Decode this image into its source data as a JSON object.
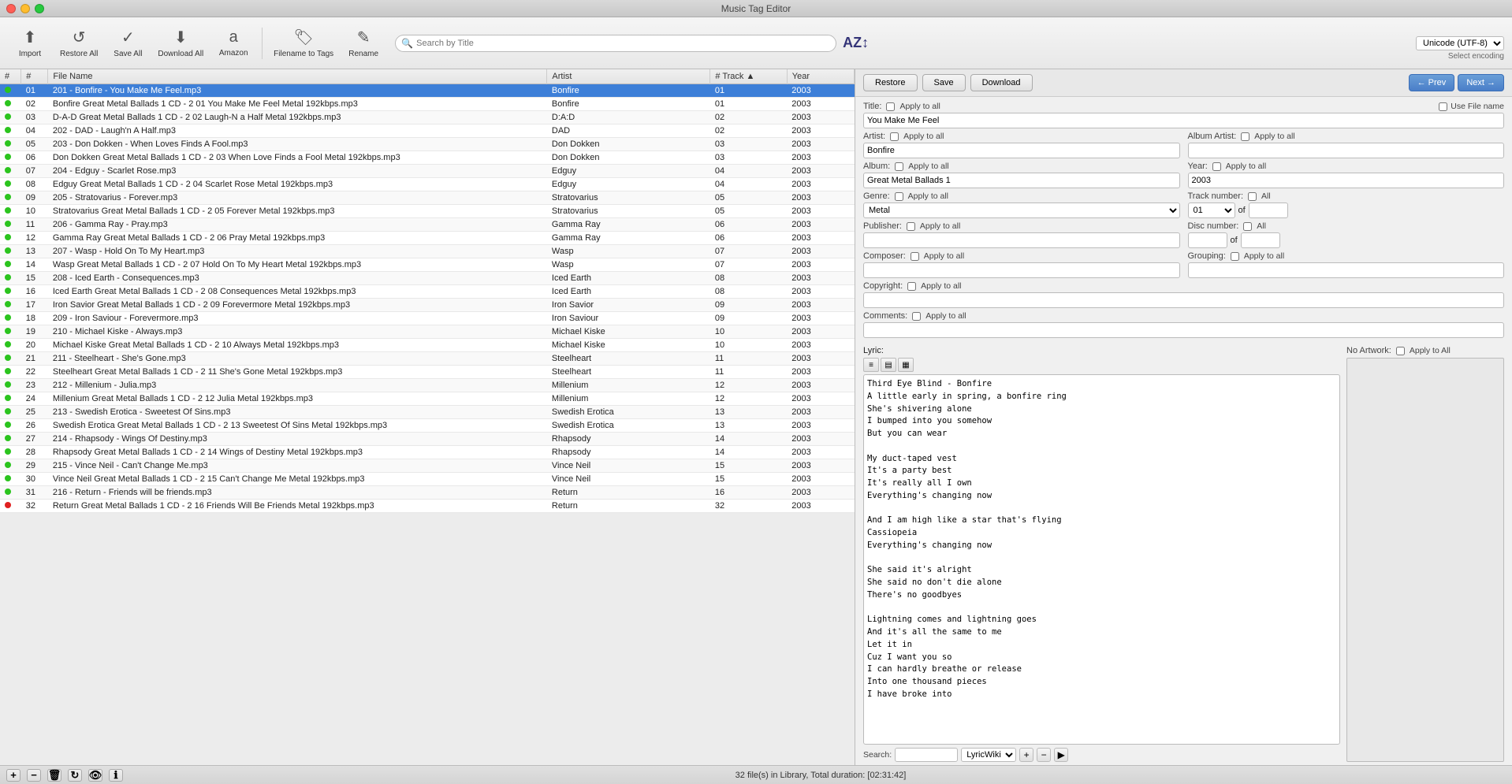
{
  "window": {
    "title": "Music Tag Editor"
  },
  "toolbar": {
    "import_label": "Import",
    "restore_all_label": "Restore All",
    "save_all_label": "Save All",
    "download_all_label": "Download All",
    "amazon_label": "Amazon",
    "filename_to_tags_label": "Filename to Tags",
    "rename_label": "Rename",
    "search_placeholder": "Search by Title",
    "encoding_label": "Select encoding",
    "encoding_value": "Unicode (UTF-8)"
  },
  "columns": {
    "hash": "#",
    "num": "#",
    "filename": "File Name",
    "artist": "Artist",
    "track": "# Track",
    "year": "Year"
  },
  "files": [
    {
      "dot": "green",
      "num": "01",
      "filename": "201 - Bonfire - You Make Me Feel.mp3",
      "artist": "Bonfire",
      "track": "01",
      "year": "2003",
      "selected": true
    },
    {
      "dot": "green",
      "num": "02",
      "filename": "Bonfire Great Metal Ballads 1 CD - 2 01 You Make Me Feel Metal 192kbps.mp3",
      "artist": "Bonfire",
      "track": "01",
      "year": "2003",
      "selected": false
    },
    {
      "dot": "green",
      "num": "03",
      "filename": "D-A-D Great Metal Ballads 1 CD - 2 02 Laugh-N a Half Metal 192kbps.mp3",
      "artist": "D:A:D",
      "track": "02",
      "year": "2003",
      "selected": false
    },
    {
      "dot": "green",
      "num": "04",
      "filename": "202 - DAD - Laugh'n A Half.mp3",
      "artist": "DAD",
      "track": "02",
      "year": "2003",
      "selected": false
    },
    {
      "dot": "green",
      "num": "05",
      "filename": "203 - Don Dokken - When Loves Finds A Fool.mp3",
      "artist": "Don Dokken",
      "track": "03",
      "year": "2003",
      "selected": false
    },
    {
      "dot": "green",
      "num": "06",
      "filename": "Don Dokken Great Metal Ballads 1 CD - 2 03 When Love Finds a Fool Metal 192kbps.mp3",
      "artist": "Don Dokken",
      "track": "03",
      "year": "2003",
      "selected": false
    },
    {
      "dot": "green",
      "num": "07",
      "filename": "204 - Edguy - Scarlet Rose.mp3",
      "artist": "Edguy",
      "track": "04",
      "year": "2003",
      "selected": false
    },
    {
      "dot": "green",
      "num": "08",
      "filename": "Edguy Great Metal Ballads 1 CD - 2 04 Scarlet Rose Metal 192kbps.mp3",
      "artist": "Edguy",
      "track": "04",
      "year": "2003",
      "selected": false
    },
    {
      "dot": "green",
      "num": "09",
      "filename": "205 - Stratovarius - Forever.mp3",
      "artist": "Stratovarius",
      "track": "05",
      "year": "2003",
      "selected": false
    },
    {
      "dot": "green",
      "num": "10",
      "filename": "Stratovarius Great Metal Ballads 1 CD - 2 05 Forever Metal 192kbps.mp3",
      "artist": "Stratovarius",
      "track": "05",
      "year": "2003",
      "selected": false
    },
    {
      "dot": "green",
      "num": "11",
      "filename": "206 - Gamma Ray - Pray.mp3",
      "artist": "Gamma Ray",
      "track": "06",
      "year": "2003",
      "selected": false
    },
    {
      "dot": "green",
      "num": "12",
      "filename": "Gamma Ray Great Metal Ballads 1 CD - 2 06 Pray Metal 192kbps.mp3",
      "artist": "Gamma Ray",
      "track": "06",
      "year": "2003",
      "selected": false
    },
    {
      "dot": "green",
      "num": "13",
      "filename": "207 - Wasp - Hold On To My Heart.mp3",
      "artist": "Wasp",
      "track": "07",
      "year": "2003",
      "selected": false
    },
    {
      "dot": "green",
      "num": "14",
      "filename": "Wasp Great Metal Ballads 1 CD - 2 07 Hold On To My Heart Metal 192kbps.mp3",
      "artist": "Wasp",
      "track": "07",
      "year": "2003",
      "selected": false
    },
    {
      "dot": "green",
      "num": "15",
      "filename": "208 - Iced Earth - Consequences.mp3",
      "artist": "Iced Earth",
      "track": "08",
      "year": "2003",
      "selected": false
    },
    {
      "dot": "green",
      "num": "16",
      "filename": "Iced Earth Great Metal Ballads 1 CD - 2 08 Consequences Metal 192kbps.mp3",
      "artist": "Iced Earth",
      "track": "08",
      "year": "2003",
      "selected": false
    },
    {
      "dot": "green",
      "num": "17",
      "filename": "Iron Savior Great Metal Ballads 1 CD - 2 09 Forevermore Metal 192kbps.mp3",
      "artist": "Iron Savior",
      "track": "09",
      "year": "2003",
      "selected": false
    },
    {
      "dot": "green",
      "num": "18",
      "filename": "209 - Iron Saviour - Forevermore.mp3",
      "artist": "Iron Saviour",
      "track": "09",
      "year": "2003",
      "selected": false
    },
    {
      "dot": "green",
      "num": "19",
      "filename": "210 - Michael Kiske - Always.mp3",
      "artist": "Michael Kiske",
      "track": "10",
      "year": "2003",
      "selected": false
    },
    {
      "dot": "green",
      "num": "20",
      "filename": "Michael Kiske Great Metal Ballads 1 CD - 2 10 Always Metal 192kbps.mp3",
      "artist": "Michael Kiske",
      "track": "10",
      "year": "2003",
      "selected": false
    },
    {
      "dot": "green",
      "num": "21",
      "filename": "211 - Steelheart - She's Gone.mp3",
      "artist": "Steelheart",
      "track": "11",
      "year": "2003",
      "selected": false
    },
    {
      "dot": "green",
      "num": "22",
      "filename": "Steelheart Great Metal Ballads 1 CD - 2 11 She's Gone Metal 192kbps.mp3",
      "artist": "Steelheart",
      "track": "11",
      "year": "2003",
      "selected": false
    },
    {
      "dot": "green",
      "num": "23",
      "filename": "212 - Millenium - Julia.mp3",
      "artist": "Millenium",
      "track": "12",
      "year": "2003",
      "selected": false
    },
    {
      "dot": "green",
      "num": "24",
      "filename": "Millenium Great Metal Ballads 1 CD - 2 12 Julia Metal 192kbps.mp3",
      "artist": "Millenium",
      "track": "12",
      "year": "2003",
      "selected": false
    },
    {
      "dot": "green",
      "num": "25",
      "filename": "213 - Swedish Erotica - Sweetest Of Sins.mp3",
      "artist": "Swedish Erotica",
      "track": "13",
      "year": "2003",
      "selected": false
    },
    {
      "dot": "green",
      "num": "26",
      "filename": "Swedish Erotica Great Metal Ballads 1 CD - 2 13 Sweetest Of Sins Metal 192kbps.mp3",
      "artist": "Swedish Erotica",
      "track": "13",
      "year": "2003",
      "selected": false
    },
    {
      "dot": "green",
      "num": "27",
      "filename": "214 - Rhapsody - Wings Of Destiny.mp3",
      "artist": "Rhapsody",
      "track": "14",
      "year": "2003",
      "selected": false
    },
    {
      "dot": "green",
      "num": "28",
      "filename": "Rhapsody Great Metal Ballads 1 CD - 2 14 Wings of Destiny Metal 192kbps.mp3",
      "artist": "Rhapsody",
      "track": "14",
      "year": "2003",
      "selected": false
    },
    {
      "dot": "green",
      "num": "29",
      "filename": "215 - Vince Neil - Can't Change Me.mp3",
      "artist": "Vince Neil",
      "track": "15",
      "year": "2003",
      "selected": false
    },
    {
      "dot": "green",
      "num": "30",
      "filename": "Vince Neil Great Metal Ballads 1 CD - 2 15 Can't Change Me Metal 192kbps.mp3",
      "artist": "Vince Neil",
      "track": "15",
      "year": "2003",
      "selected": false
    },
    {
      "dot": "green",
      "num": "31",
      "filename": "216 - Return - Friends will be friends.mp3",
      "artist": "Return",
      "track": "16",
      "year": "2003",
      "selected": false
    },
    {
      "dot": "red",
      "num": "32",
      "filename": "Return Great Metal Ballads 1 CD - 2 16 Friends Will Be Friends Metal 192kbps.mp3",
      "artist": "Return",
      "track": "32",
      "year": "2003",
      "selected": false
    }
  ],
  "panel": {
    "restore_btn": "Restore",
    "save_btn": "Save",
    "download_btn": "Download",
    "prev_btn": "← Prev",
    "next_btn": "Next →",
    "title_label": "Title:",
    "apply_all_label": "Apply to all",
    "use_file_name_label": "Use File name",
    "title_value": "You Make Me Feel",
    "artist_label": "Artist:",
    "artist_value": "Bonfire",
    "album_artist_label": "Album Artist:",
    "album_label": "Album:",
    "album_value": "Great Metal Ballads 1",
    "year_label": "Year:",
    "year_value": "2003",
    "genre_label": "Genre:",
    "genre_value": "Metal",
    "track_number_label": "Track number:",
    "track_value": "01",
    "all_label": "All",
    "publisher_label": "Publisher:",
    "disc_number_label": "Disc number:",
    "of_label": "of",
    "composer_label": "Composer:",
    "grouping_label": "Grouping:",
    "copyright_label": "Copyright:",
    "comments_label": "Comments:",
    "lyric_label": "Lyric:",
    "no_artwork_label": "No Artwork:",
    "apply_to_all_artwork": "Apply to All",
    "lyric_content": "Third Eye Blind - Bonfire\nA little early in spring, a bonfire ring\nShe's shivering alone\nI bumped into you somehow\nBut you can wear\n\nMy duct-taped vest\nIt's a party best\nIt's really all I own\nEverything's changing now\n\nAnd I am high like a star that's flying\nCassiopeia\nEverything's changing now\n\nShe said it's alright\nShe said no don't die alone\nThere's no goodbyes\n\nLightning comes and lightning goes\nAnd it's all the same to me\nLet it in\nCuz I want you so\nI can hardly breathe or release\nInto one thousand pieces\nI have broke into",
    "lyric_search_placeholder": "Search",
    "lyric_source": "LyricWiki"
  },
  "status": {
    "text": "32 file(s) in Library, Total duration: [02:31:42]"
  }
}
